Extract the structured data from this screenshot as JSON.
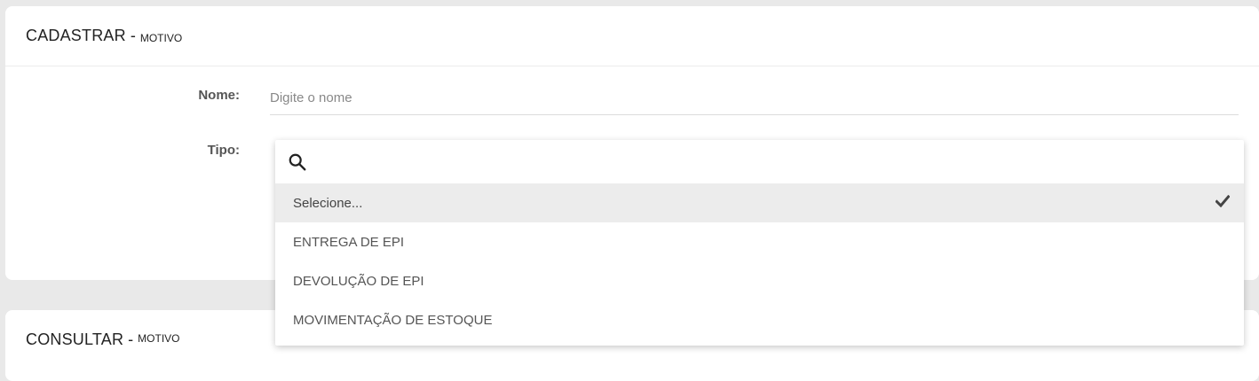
{
  "register_card": {
    "title": "CADASTRAR",
    "separator": "-",
    "subtitle": "MOTIVO"
  },
  "form": {
    "name_label": "Nome:",
    "name_placeholder": "Digite o nome",
    "name_value": "",
    "type_label": "Tipo:"
  },
  "type_dropdown": {
    "search_value": "",
    "selected_index": 0,
    "options": [
      {
        "label": "Selecione..."
      },
      {
        "label": "ENTREGA DE EPI"
      },
      {
        "label": "DEVOLUÇÃO DE EPI"
      },
      {
        "label": "MOVIMENTAÇÃO DE ESTOQUE"
      }
    ]
  },
  "consult_card": {
    "title": "CONSULTAR",
    "separator": "-",
    "subtitle": "MOTIVO"
  },
  "icons": {
    "search": "search-icon",
    "check": "check-icon"
  },
  "colors": {
    "background": "#e9e9e9",
    "card": "#ffffff",
    "selected_option": "#ececec"
  }
}
